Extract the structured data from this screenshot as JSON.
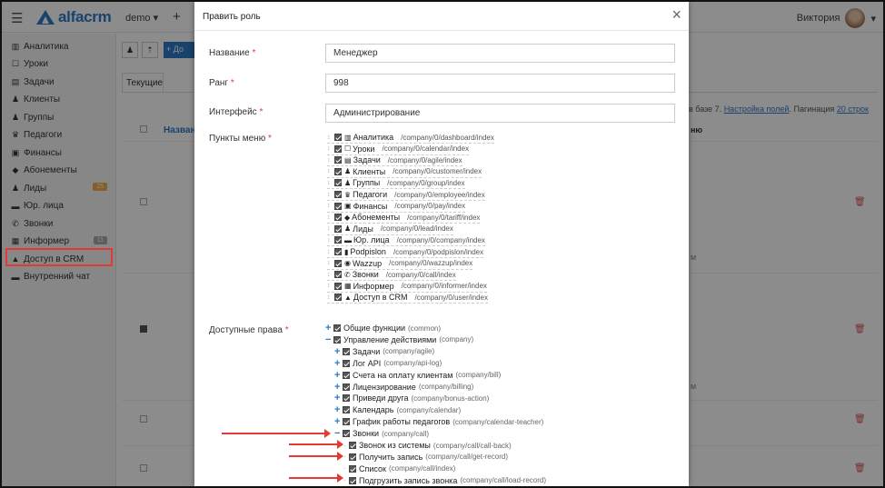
{
  "topbar": {
    "branch": "demo ▾",
    "add": "+",
    "user": "Виктория",
    "user_caret": "▾"
  },
  "logo": {
    "text": "alfacrm"
  },
  "sidebar": {
    "items": [
      {
        "label": "Аналитика",
        "icon": "chart-icon",
        "glyph": "▥"
      },
      {
        "label": "Уроки",
        "icon": "lessons-icon",
        "glyph": "☐"
      },
      {
        "label": "Задачи",
        "icon": "tasks-icon",
        "glyph": "▤"
      },
      {
        "label": "Клиенты",
        "icon": "user-icon",
        "glyph": "♟"
      },
      {
        "label": "Группы",
        "icon": "group-icon",
        "glyph": "♟"
      },
      {
        "label": "Педагоги",
        "icon": "teacher-icon",
        "glyph": "♛"
      },
      {
        "label": "Финансы",
        "icon": "money-icon",
        "glyph": "▣"
      },
      {
        "label": "Абонементы",
        "icon": "tag-icon",
        "glyph": "◆"
      },
      {
        "label": "Лиды",
        "icon": "leads-icon",
        "glyph": "♟",
        "badge": "25",
        "badge_color": "#f0ad4e"
      },
      {
        "label": "Юр. лица",
        "icon": "building-icon",
        "glyph": "▬"
      },
      {
        "label": "Звонки",
        "icon": "phone-icon",
        "glyph": "✆"
      },
      {
        "label": "Информер",
        "icon": "informer-icon",
        "glyph": "▦",
        "badge": "11",
        "badge_color": "#aaaaaa"
      },
      {
        "label": "Доступ в CRM",
        "icon": "lock-icon",
        "glyph": "▲"
      },
      {
        "label": "Внутренний чат",
        "icon": "chat-icon",
        "glyph": "▬"
      }
    ]
  },
  "background": {
    "tab": "Текущие",
    "name_col": "Назван",
    "add_btn": "+ До",
    "right_text": "в базе 7.",
    "settings_link": "Настройка полей",
    "pagination": "Пагинация",
    "pagination_link": "20 строк",
    "col2": "ню",
    "m1": "м",
    "m2": "м"
  },
  "modal": {
    "title": "Править роль",
    "close": "×",
    "fields": {
      "name_label": "Название",
      "name_value": "Менеджер",
      "rank_label": "Ранг",
      "rank_value": "998",
      "interface_label": "Интерфейс",
      "interface_value": "Администрирование",
      "menu_label": "Пункты меню",
      "rights_label": "Доступные права",
      "required_mark": "*"
    },
    "menu_items": [
      {
        "glyph": "▥",
        "icon": "chart-icon",
        "label": "Аналитика",
        "path": "/company/0/dashboard/index"
      },
      {
        "glyph": "☐",
        "icon": "lessons-icon",
        "label": "Уроки",
        "path": "/company/0/calendar/index"
      },
      {
        "glyph": "▤",
        "icon": "tasks-icon",
        "label": "Задачи",
        "path": "/company/0/agile/index"
      },
      {
        "glyph": "♟",
        "icon": "user-icon",
        "label": "Клиенты",
        "path": "/company/0/customer/index"
      },
      {
        "glyph": "♟",
        "icon": "group-icon",
        "label": "Группы",
        "path": "/company/0/group/index"
      },
      {
        "glyph": "♛",
        "icon": "teacher-icon",
        "label": "Педагоги",
        "path": "/company/0/employee/index"
      },
      {
        "glyph": "▣",
        "icon": "money-icon",
        "label": "Финансы",
        "path": "/company/0/pay/index"
      },
      {
        "glyph": "◆",
        "icon": "tag-icon",
        "label": "Абонементы",
        "path": "/company/0/tariff/index"
      },
      {
        "glyph": "♟",
        "icon": "leads-icon",
        "label": "Лиды",
        "path": "/company/0/lead/index"
      },
      {
        "glyph": "▬",
        "icon": "building-icon",
        "label": "Юр. лица",
        "path": "/company/0/company/index"
      },
      {
        "glyph": "▮",
        "icon": "document-icon",
        "label": "Podpislon",
        "path": "/company/0/podpislon/index"
      },
      {
        "glyph": "◉",
        "icon": "whatsapp-icon",
        "label": "Wazzup",
        "path": "/company/0/wazzup/index"
      },
      {
        "glyph": "✆",
        "icon": "phone-icon",
        "label": "Звонки",
        "path": "/company/0/call/index"
      },
      {
        "glyph": "▦",
        "icon": "informer-icon",
        "label": "Информер",
        "path": "/company/0/informer/index"
      },
      {
        "glyph": "▲",
        "icon": "lock-icon",
        "label": "Доступ в CRM",
        "path": "/company/0/user/index"
      }
    ],
    "rights": [
      {
        "toggle": "+",
        "label": "Общие функции",
        "code": "(common)",
        "level": 0
      },
      {
        "toggle": "−",
        "label": "Управление действиями",
        "code": "(company)",
        "level": 0
      },
      {
        "toggle": "+",
        "label": "Задачи",
        "code": "(company/agile)",
        "level": 1
      },
      {
        "toggle": "+",
        "label": "Лог API",
        "code": "(company/api-log)",
        "level": 1
      },
      {
        "toggle": "+",
        "label": "Счета на оплату клиентам",
        "code": "(company/bill)",
        "level": 1
      },
      {
        "toggle": "+",
        "label": "Лицензирование",
        "code": "(company/billing)",
        "level": 1
      },
      {
        "toggle": "+",
        "label": "Приведи друга",
        "code": "(company/bonus-action)",
        "level": 1
      },
      {
        "toggle": "+",
        "label": "Календарь",
        "code": "(company/calendar)",
        "level": 1
      },
      {
        "toggle": "+",
        "label": "График работы педагогов",
        "code": "(company/calendar-teacher)",
        "level": 1
      },
      {
        "toggle": "−",
        "label": "Звонки",
        "code": "(company/call)",
        "level": 1
      },
      {
        "toggle": "·",
        "label": "Звонок из системы",
        "code": "(company/call/call-back)",
        "level": 2
      },
      {
        "toggle": "·",
        "label": "Получить запись",
        "code": "(company/call/get-record)",
        "level": 2
      },
      {
        "toggle": "·",
        "label": "Список",
        "code": "(company/call/index)",
        "level": 2
      },
      {
        "toggle": "·",
        "label": "Подгрузить запись звонка",
        "code": "(company/call/load-record)",
        "level": 2
      }
    ]
  },
  "colors": {
    "accent": "#2e78c7",
    "annotation": "#e53935",
    "trash": "#d9534f"
  }
}
